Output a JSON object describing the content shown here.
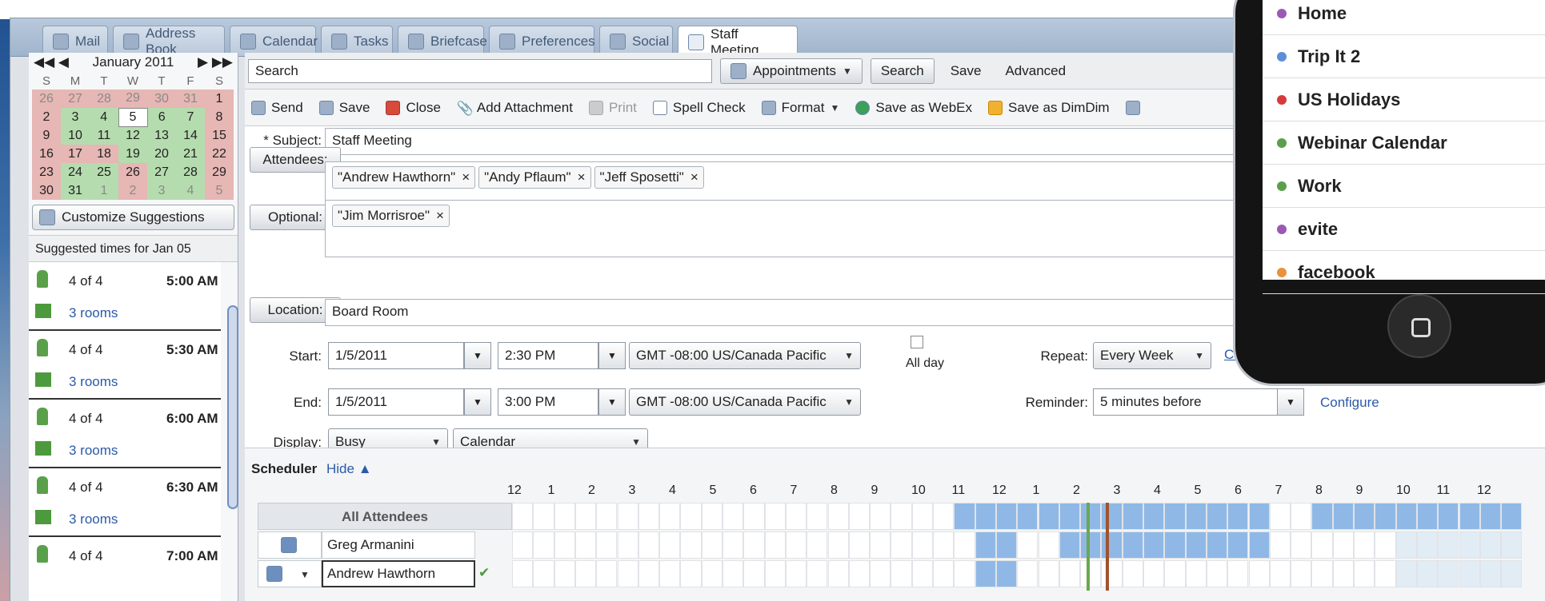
{
  "tabs": [
    {
      "label": "Mail"
    },
    {
      "label": "Address Book"
    },
    {
      "label": "Calendar"
    },
    {
      "label": "Tasks"
    },
    {
      "label": "Briefcase"
    },
    {
      "label": "Preferences"
    },
    {
      "label": "Social"
    },
    {
      "label": "Staff Meeting"
    }
  ],
  "mini_cal": {
    "month": "January 2011",
    "dow": [
      "S",
      "M",
      "T",
      "W",
      "T",
      "F",
      "S"
    ],
    "weeks": [
      [
        "26",
        "27",
        "28",
        "29",
        "30",
        "31",
        "1"
      ],
      [
        "2",
        "3",
        "4",
        "5",
        "6",
        "7",
        "8"
      ],
      [
        "9",
        "10",
        "11",
        "12",
        "13",
        "14",
        "15"
      ],
      [
        "16",
        "17",
        "18",
        "19",
        "20",
        "21",
        "22"
      ],
      [
        "23",
        "24",
        "25",
        "26",
        "27",
        "28",
        "29"
      ],
      [
        "30",
        "31",
        "1",
        "2",
        "3",
        "4",
        "5"
      ]
    ]
  },
  "customize_label": "Customize Suggestions",
  "suggested_header": "Suggested times for Jan 05",
  "slots": [
    {
      "count": "4 of 4",
      "time": "5:00 AM",
      "rooms": "3 rooms"
    },
    {
      "count": "4 of 4",
      "time": "5:30 AM",
      "rooms": "3 rooms"
    },
    {
      "count": "4 of 4",
      "time": "6:00 AM",
      "rooms": "3 rooms"
    },
    {
      "count": "4 of 4",
      "time": "6:30 AM",
      "rooms": "3 rooms"
    },
    {
      "count": "4 of 4",
      "time": "7:00 AM",
      "rooms": ""
    }
  ],
  "search": {
    "value": "Search",
    "type_label": "Appointments",
    "search_btn": "Search",
    "save": "Save",
    "advanced": "Advanced"
  },
  "toolbar": {
    "send": "Send",
    "save": "Save",
    "close": "Close",
    "attach": "Add Attachment",
    "print": "Print",
    "spell": "Spell Check",
    "format": "Format",
    "webex": "Save as WebEx",
    "dimdim": "Save as DimDim"
  },
  "form": {
    "subject_label": "* Subject:",
    "subject": "Staff Meeting",
    "attendees_btn": "Attendees:",
    "attendees": [
      "\"Andrew Hawthorn\"",
      "\"Andy Pflaum\"",
      "\"Jeff Sposetti\""
    ],
    "optional_btn": "Optional:",
    "optional": [
      "\"Jim Morrisroe\""
    ],
    "location_btn": "Location:",
    "location": "Board Room",
    "start_label": "Start:",
    "start_date": "1/5/2011",
    "start_time": "2:30 PM",
    "tz": "GMT -08:00 US/Canada Pacific",
    "end_label": "End:",
    "end_date": "1/5/2011",
    "end_time": "3:00 PM",
    "allday": "All day",
    "repeat_label": "Repeat:",
    "repeat": "Every Week",
    "customize_link": "Customi",
    "reminder_label": "Reminder:",
    "reminder": "5 minutes before",
    "configure": "Configure",
    "display_label": "Display:",
    "display": "Busy",
    "calendar": "Calendar"
  },
  "scheduler": {
    "title": "Scheduler",
    "hide": "Hide",
    "hours": [
      "12",
      "1",
      "2",
      "3",
      "4",
      "5",
      "6",
      "7",
      "8",
      "9",
      "10",
      "11",
      "12",
      "1",
      "2",
      "3",
      "4",
      "5",
      "6",
      "7",
      "8",
      "9",
      "10",
      "11",
      "12"
    ],
    "rows": [
      {
        "name": "All Attendees"
      },
      {
        "name": "Greg Armanini"
      },
      {
        "name": "Andrew Hawthorn"
      }
    ]
  },
  "phone": {
    "calendars": [
      {
        "name": "Home",
        "color": "#9b59b6"
      },
      {
        "name": "Trip It 2",
        "color": "#5b8fd6"
      },
      {
        "name": "US Holidays",
        "color": "#d63b3b"
      },
      {
        "name": "Webinar Calendar",
        "color": "#5aa04a"
      },
      {
        "name": "Work",
        "color": "#5aa04a"
      },
      {
        "name": "evite",
        "color": "#9b59b6"
      },
      {
        "name": "facebook",
        "color": "#e8923a"
      }
    ]
  }
}
